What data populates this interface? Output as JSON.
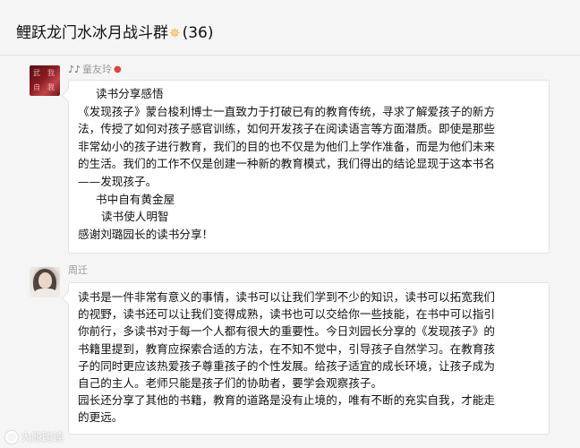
{
  "header": {
    "group_name": "鲤跃龙门水冰月战斗群",
    "member_count": "(36)",
    "star_icon": "sparkle-star-icon"
  },
  "messages": [
    {
      "sender": "童友玲",
      "sender_prefix_icon": "music-note-icon",
      "sender_suffix_icon": "pin-icon",
      "avatar_text": [
        "武",
        "我",
        "自",
        "我"
      ],
      "lines": [
        "读书分享感悟",
        "《发现孩子》蒙台梭利博士一直致力于打破已有的教育传统，寻求了解爱孩子的新方",
        "法，传授了如何对孩子感官训练，如何开发孩子在阅读语言等方面潜质。即使是那些",
        "非常幼小的孩子进行教育，我们的目的也不仅是为他们上学作准备，而是为他们未来",
        "的生活。我们的工作不仅是创建一种新的教育模式，我们得出的结论显现于这本书名",
        "——发现孩子。",
        "书中自有黄金屋",
        "读书使人明智",
        "感谢刘璐园长的读书分享！"
      ]
    },
    {
      "sender": "周迁",
      "lines": [
        "读书是一件非常有意义的事情，读书可以让我们学到不少的知识，读书可以拓宽我们",
        "的视野，读书还可以让我们变得成熟，读书也可以交给你一些技能，在书中可以指引",
        "你前行，多读书对于每一个人都有很大的重要性。今日刘园长分享的《发现孩子》的",
        "书籍里提到，教育应探索合适的方法，在不知不觉中，引导孩子自然学习。在教育孩",
        "子的同时更应该热爱孩子尊重孩子的个性发展。给孩子适宜的成长环境，让孩子成为",
        "自己的主人。老师只能是孩子们的协助者，要学会观察孩子。",
        "园长还分享了其他的书籍，教育的道路是没有止境的，唯有不断的充实自我，才能走",
        "的更远。"
      ]
    }
  ],
  "watermark": {
    "text": "大鲸跨读"
  }
}
